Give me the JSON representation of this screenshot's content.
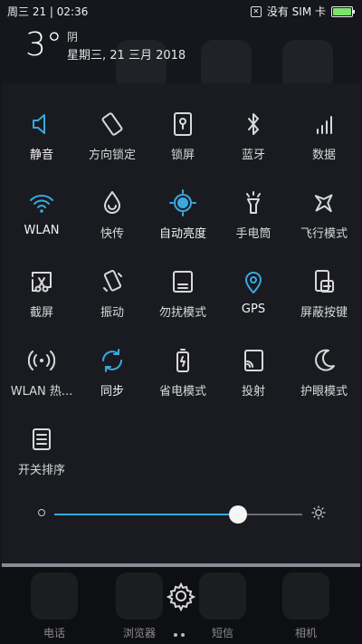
{
  "status_bar": {
    "left_text": "周三 21 | 02:36",
    "signal_text": "没有 SIM 卡",
    "battery_level": 0.9,
    "battery_color": "#7be36a"
  },
  "weather": {
    "temperature": "3°",
    "condition": "阴",
    "date": "星期三, 21 三月 2018"
  },
  "accent_color": "#39a9e0",
  "tiles": [
    {
      "label": "静音",
      "icon": "speaker-icon",
      "active": true
    },
    {
      "label": "方向锁定",
      "icon": "rotation-lock-icon",
      "active": false
    },
    {
      "label": "锁屏",
      "icon": "lock-screen-icon",
      "active": false
    },
    {
      "label": "蓝牙",
      "icon": "bluetooth-icon",
      "active": false
    },
    {
      "label": "数据",
      "icon": "mobile-data-icon",
      "active": false
    },
    {
      "label": "WLAN",
      "icon": "wifi-icon",
      "active": true
    },
    {
      "label": "快传",
      "icon": "quick-transfer-icon",
      "active": false
    },
    {
      "label": "自动亮度",
      "icon": "auto-brightness-icon",
      "active": true
    },
    {
      "label": "手电筒",
      "icon": "flashlight-icon",
      "active": false
    },
    {
      "label": "飞行模式",
      "icon": "airplane-icon",
      "active": false
    },
    {
      "label": "截屏",
      "icon": "screenshot-icon",
      "active": false
    },
    {
      "label": "振动",
      "icon": "vibrate-icon",
      "active": false
    },
    {
      "label": "勿扰模式",
      "icon": "do-not-disturb-icon",
      "active": false
    },
    {
      "label": "GPS",
      "icon": "location-pin-icon",
      "active": true
    },
    {
      "label": "屏蔽按键",
      "icon": "block-keys-icon",
      "active": false
    },
    {
      "label": "WLAN 热...",
      "icon": "hotspot-icon",
      "active": false
    },
    {
      "label": "同步",
      "icon": "sync-icon",
      "active": true
    },
    {
      "label": "省电模式",
      "icon": "battery-saver-icon",
      "active": false
    },
    {
      "label": "投射",
      "icon": "cast-icon",
      "active": false
    },
    {
      "label": "护眼模式",
      "icon": "eye-care-moon-icon",
      "active": false
    },
    {
      "label": "开关排序",
      "icon": "toggle-order-icon",
      "active": false
    }
  ],
  "brightness": {
    "level": 0.74
  },
  "dock": [
    {
      "label": "电话"
    },
    {
      "label": "浏览器"
    },
    {
      "label": "短信"
    },
    {
      "label": "相机"
    }
  ]
}
